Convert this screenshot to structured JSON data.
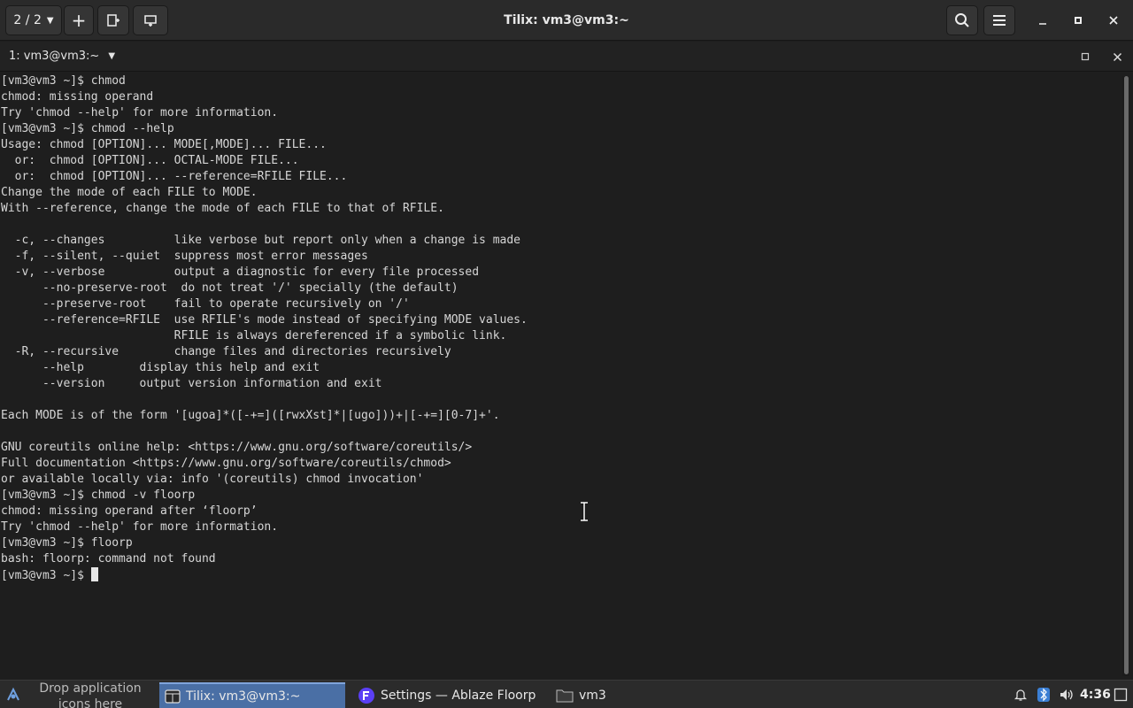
{
  "titlebar": {
    "session_counter": "2 / 2",
    "window_title": "Tilix: vm3@vm3:~"
  },
  "terminal_header": {
    "title": "1: vm3@vm3:~"
  },
  "terminal": {
    "lines": [
      "[vm3@vm3 ~]$ chmod",
      "chmod: missing operand",
      "Try 'chmod --help' for more information.",
      "[vm3@vm3 ~]$ chmod --help",
      "Usage: chmod [OPTION]... MODE[,MODE]... FILE...",
      "  or:  chmod [OPTION]... OCTAL-MODE FILE...",
      "  or:  chmod [OPTION]... --reference=RFILE FILE...",
      "Change the mode of each FILE to MODE.",
      "With --reference, change the mode of each FILE to that of RFILE.",
      "",
      "  -c, --changes          like verbose but report only when a change is made",
      "  -f, --silent, --quiet  suppress most error messages",
      "  -v, --verbose          output a diagnostic for every file processed",
      "      --no-preserve-root  do not treat '/' specially (the default)",
      "      --preserve-root    fail to operate recursively on '/'",
      "      --reference=RFILE  use RFILE's mode instead of specifying MODE values.",
      "                         RFILE is always dereferenced if a symbolic link.",
      "  -R, --recursive        change files and directories recursively",
      "      --help        display this help and exit",
      "      --version     output version information and exit",
      "",
      "Each MODE is of the form '[ugoa]*([-+=]([rwxXst]*|[ugo]))+|[-+=][0-7]+'.",
      "",
      "GNU coreutils online help: <https://www.gnu.org/software/coreutils/>",
      "Full documentation <https://www.gnu.org/software/coreutils/chmod>",
      "or available locally via: info '(coreutils) chmod invocation'",
      "[vm3@vm3 ~]$ chmod -v floorp",
      "chmod: missing operand after ‘floorp’",
      "Try 'chmod --help' for more information.",
      "[vm3@vm3 ~]$ floorp",
      "bash: floorp: command not found"
    ],
    "prompt": "[vm3@vm3 ~]$"
  },
  "taskbar": {
    "drop_hint": "Drop application icons here",
    "tasks": [
      {
        "label": "Tilix: vm3@vm3:~",
        "icon": "tilix-icon",
        "active": true
      },
      {
        "label": "Settings — Ablaze Floorp",
        "icon": "floorp-icon",
        "active": false
      },
      {
        "label": "vm3",
        "icon": "folder-icon",
        "active": false
      }
    ],
    "clock": "4:36"
  },
  "colors": {
    "terminal_bg": "#1e1e1e",
    "terminal_fg": "#d6d6d6",
    "titlebar_bg": "#2a2a2a",
    "taskbar_active": "#4a6fa5",
    "floorp_accent": "#5b3ff5"
  }
}
